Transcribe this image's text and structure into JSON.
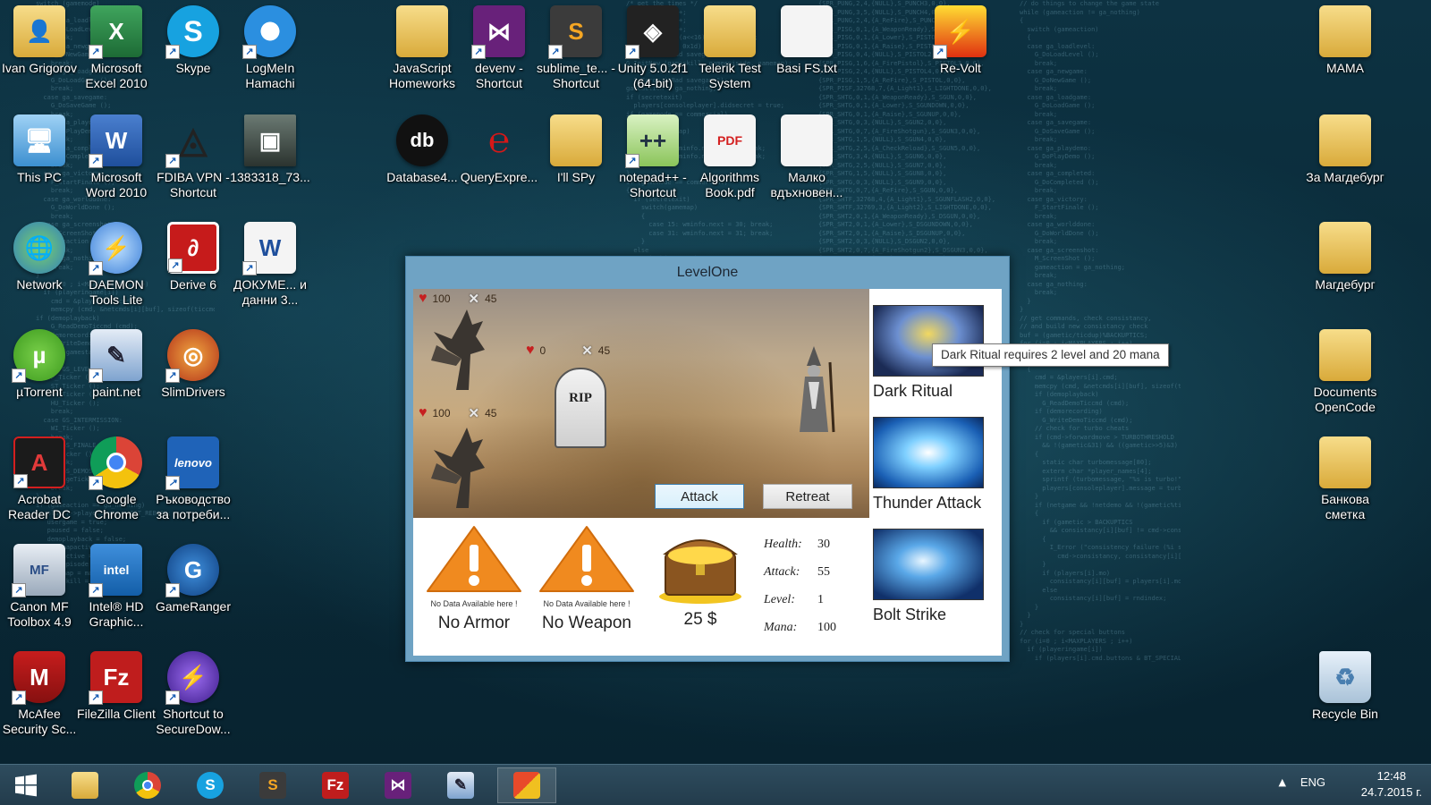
{
  "desktop": {
    "icons": [
      {
        "id": "ivan",
        "label": "Ivan Grigorov"
      },
      {
        "id": "excel",
        "label": "Microsoft Excel 2010"
      },
      {
        "id": "skype",
        "label": "Skype"
      },
      {
        "id": "hamachi",
        "label": "LogMeIn Hamachi"
      },
      {
        "id": "jshomeworks",
        "label": "JavaScript Homeworks"
      },
      {
        "id": "devenv",
        "label": "devenv - Shortcut"
      },
      {
        "id": "sublime",
        "label": "sublime_te... - Shortcut"
      },
      {
        "id": "unity",
        "label": "Unity 5.0.2f1 (64-bit)"
      },
      {
        "id": "telerik",
        "label": "Telerik Test System"
      },
      {
        "id": "basifs",
        "label": "Basi FS.txt"
      },
      {
        "id": "revolt",
        "label": "Re-Volt"
      },
      {
        "id": "mama",
        "label": "MAMA"
      },
      {
        "id": "thispc",
        "label": "This PC"
      },
      {
        "id": "word",
        "label": "Microsoft Word 2010"
      },
      {
        "id": "fdiba",
        "label": "FDIBA VPN - Shortcut"
      },
      {
        "id": "photo",
        "label": "1383318_73..."
      },
      {
        "id": "database",
        "label": "Database4..."
      },
      {
        "id": "queryexpress",
        "label": "QueryExpre..."
      },
      {
        "id": "illspy",
        "label": "I'll SPy"
      },
      {
        "id": "notepadpp",
        "label": "notepad++ - Shortcut"
      },
      {
        "id": "algorithms",
        "label": "Algorithms Book.pdf"
      },
      {
        "id": "malko",
        "label": "Малко вдъхновен..."
      },
      {
        "id": "zamagdeburg",
        "label": "За Магдебург"
      },
      {
        "id": "network",
        "label": "Network"
      },
      {
        "id": "daemon",
        "label": "DAEMON Tools Lite"
      },
      {
        "id": "derive",
        "label": "Derive 6"
      },
      {
        "id": "dokume",
        "label": "ДОКУМЕ... и данни 3..."
      },
      {
        "id": "magdeburg",
        "label": "Магдебург"
      },
      {
        "id": "utorrent",
        "label": "µTorrent"
      },
      {
        "id": "paint",
        "label": "paint.net"
      },
      {
        "id": "slimdrivers",
        "label": "SlimDrivers"
      },
      {
        "id": "docsopencode",
        "label": "Documents OpenCode"
      },
      {
        "id": "acrobat",
        "label": "Acrobat Reader DC"
      },
      {
        "id": "chrome",
        "label": "Google Chrome"
      },
      {
        "id": "lenovo",
        "label": "Ръководство за потреби..."
      },
      {
        "id": "bankova",
        "label": "Банкова сметка"
      },
      {
        "id": "canon",
        "label": "Canon MF Toolbox 4.9"
      },
      {
        "id": "intelhd",
        "label": "Intel® HD Graphic..."
      },
      {
        "id": "gameranger",
        "label": "GameRanger"
      },
      {
        "id": "mcafee",
        "label": "McAfee Security Sc..."
      },
      {
        "id": "filezilla",
        "label": "FileZilla Client"
      },
      {
        "id": "securedow",
        "label": "Shortcut to SecureDow..."
      },
      {
        "id": "recyclebin",
        "label": "Recycle Bin"
      }
    ]
  },
  "game": {
    "window_title": "LevelOne",
    "enemies": [
      {
        "health": "100",
        "attack": "45"
      },
      {
        "health": "0",
        "attack": "45"
      },
      {
        "health": "100",
        "attack": "45"
      }
    ],
    "rip_text": "RIP",
    "attack_label": "Attack",
    "retreat_label": "Retreat",
    "armor": {
      "nodata": "No Data Available here !",
      "label": "No Armor"
    },
    "weapon": {
      "nodata": "No Data Available here !",
      "label": "No Weapon"
    },
    "gold": "25 $",
    "stats": [
      {
        "key": "Health:",
        "value": "30"
      },
      {
        "key": "Attack:",
        "value": "55"
      },
      {
        "key": "Level:",
        "value": "1"
      },
      {
        "key": "Mana:",
        "value": "100"
      }
    ],
    "spells": [
      {
        "name": "Dark Ritual"
      },
      {
        "name": "Thunder Attack"
      },
      {
        "name": "Bolt Strike"
      }
    ],
    "tooltip": "Dark Ritual requires 2 level and 20 mana"
  },
  "taskbar": {
    "items": [
      "windows-start",
      "file-explorer",
      "google-chrome",
      "skype",
      "sublime-text",
      "filezilla",
      "visual-studio",
      "paint-net",
      "game-app"
    ],
    "language": "ENG",
    "time": "12:48",
    "date": "24.7.2015 г."
  }
}
